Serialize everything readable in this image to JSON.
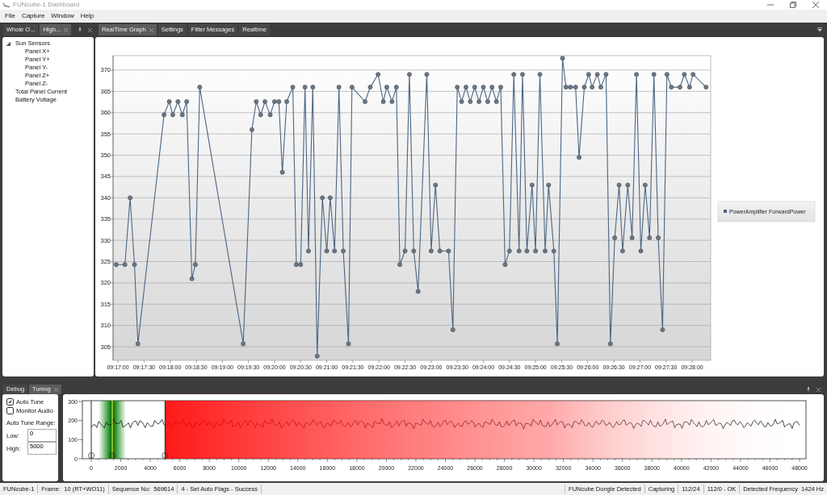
{
  "window": {
    "title": "FUNcube-1 Dashboard"
  },
  "menu": [
    "File",
    "Capture",
    "Window",
    "Help"
  ],
  "left_dock": {
    "tabs": [
      {
        "label": "Whole O...",
        "selected": false
      },
      {
        "label": "High...",
        "selected": true
      }
    ],
    "tree": [
      {
        "label": "Sun Sensors",
        "expanded": true,
        "children": [
          {
            "label": "Panel X+"
          },
          {
            "label": "Panel Y+"
          },
          {
            "label": "Panel Y-"
          },
          {
            "label": "Panel Z+"
          },
          {
            "label": "Panel Z-"
          }
        ]
      },
      {
        "label": "Total Panel Current"
      },
      {
        "label": "Battery Voltage"
      }
    ]
  },
  "main_dock": {
    "tabs": [
      {
        "label": "RealTime Graph",
        "selected": true
      },
      {
        "label": "Settings",
        "selected": false
      },
      {
        "label": "Fitter Messages",
        "selected": false
      },
      {
        "label": "Realtime",
        "selected": false
      }
    ],
    "chart_data": {
      "type": "line",
      "grid": true,
      "xlim": [
        33414.4,
        34101.3
      ],
      "ylim": [
        301.8,
        373.4
      ],
      "yticks": [
        305,
        310,
        315,
        320,
        325,
        330,
        335,
        340,
        345,
        350,
        355,
        360,
        365,
        370
      ],
      "xticks": [
        {
          "value": 33420,
          "label": "09:17:00"
        },
        {
          "value": 33450,
          "label": "09:17:30"
        },
        {
          "value": 33480,
          "label": "09:18:00"
        },
        {
          "value": 33510,
          "label": "09:18:30"
        },
        {
          "value": 33540,
          "label": "09:19:00"
        },
        {
          "value": 33570,
          "label": "09:19:30"
        },
        {
          "value": 33600,
          "label": "09:20:00"
        },
        {
          "value": 33630,
          "label": "09:20:30"
        },
        {
          "value": 33660,
          "label": "09:21:00"
        },
        {
          "value": 33690,
          "label": "09:21:30"
        },
        {
          "value": 33720,
          "label": "09:22:00"
        },
        {
          "value": 33750,
          "label": "09:22:30"
        },
        {
          "value": 33780,
          "label": "09:23:00"
        },
        {
          "value": 33810,
          "label": "09:23:30"
        },
        {
          "value": 33840,
          "label": "09:24:00"
        },
        {
          "value": 33870,
          "label": "09:24:30"
        },
        {
          "value": 33900,
          "label": "09:25:00"
        },
        {
          "value": 33930,
          "label": "09:25:30"
        },
        {
          "value": 33960,
          "label": "09:26:00"
        },
        {
          "value": 33990,
          "label": "09:26:30"
        },
        {
          "value": 34020,
          "label": "09:27:00"
        },
        {
          "value": 34050,
          "label": "09:27:30"
        },
        {
          "value": 34080,
          "label": "09:28:00"
        }
      ],
      "x": [
        33418,
        33428,
        33434,
        33439,
        33443,
        33473,
        33479,
        33483,
        33489,
        33494,
        33499,
        33505,
        33509,
        33514,
        33564,
        33574,
        33579,
        33584,
        33589,
        33595,
        33600,
        33605,
        33609,
        33614,
        33621,
        33625,
        33630,
        33635,
        33639,
        33644,
        33649,
        33655,
        33660,
        33664,
        33669,
        33674,
        33679,
        33685,
        33689,
        33704,
        33710,
        33719,
        33725,
        33729,
        33735,
        33740,
        33744,
        33750,
        33755,
        33760,
        33765,
        33775,
        33780,
        33785,
        33790,
        33800,
        33805,
        33810,
        33815,
        33820,
        33825,
        33830,
        33835,
        33840,
        33845,
        33850,
        33855,
        33860,
        33865,
        33870,
        33875,
        33881,
        33885,
        33890,
        33896,
        33900,
        33905,
        33911,
        33915,
        33921,
        33925,
        33931,
        33935,
        33940,
        33946,
        33950,
        33956,
        33961,
        33965,
        33971,
        33975,
        33981,
        33986,
        33991,
        33996,
        34000,
        34006,
        34011,
        34016,
        34021,
        34026,
        34031,
        34036,
        34041,
        34046,
        34051,
        34056,
        34066,
        34071,
        34077,
        34081,
        34096
      ],
      "series": [
        {
          "name": "PowerAmplifier ForwardPower",
          "color": "#4b6683",
          "marker": true,
          "values": [
            324.3,
            324.3,
            340,
            324.3,
            305.7,
            359.5,
            362.6,
            359.5,
            362.6,
            359.5,
            362.6,
            321,
            324.3,
            366,
            305.7,
            356,
            362.6,
            359.5,
            362.6,
            359.5,
            362.6,
            362.6,
            346,
            362.6,
            366,
            324.3,
            324.3,
            366,
            327.5,
            366,
            302.8,
            340,
            327.5,
            340,
            327.5,
            366,
            327.5,
            305.7,
            366,
            362.6,
            366,
            369,
            362.6,
            366,
            362.6,
            366,
            324.3,
            327.5,
            369,
            327.5,
            318,
            369,
            327.5,
            343,
            327.5,
            327.5,
            309,
            366,
            362.6,
            366,
            362.6,
            366,
            362.6,
            366,
            362.6,
            366,
            362.6,
            366,
            324.3,
            327.5,
            369,
            327.5,
            369,
            327.5,
            343,
            327.5,
            369,
            327.5,
            343,
            327.5,
            305.7,
            372.8,
            366,
            366,
            366,
            349.5,
            366,
            369,
            366,
            369,
            366,
            369,
            305.7,
            330.6,
            343,
            327.5,
            343,
            330.6,
            369,
            327.5,
            343,
            330.6,
            369,
            330.6,
            309,
            369,
            366,
            366,
            369,
            366,
            369,
            366
          ]
        }
      ]
    }
  },
  "bottom_dock": {
    "tabs": [
      {
        "label": "Debug",
        "selected": false
      },
      {
        "label": "Tuning",
        "selected": true
      }
    ],
    "options": [
      {
        "label": "Auto Tune",
        "checked": true
      },
      {
        "label": "Monitor Audio",
        "checked": false
      }
    ],
    "range_label": "Auto Tune Range:",
    "fields": [
      {
        "label": "Low:",
        "value": "0"
      },
      {
        "label": "High:",
        "value": "5000"
      }
    ],
    "spectrum": {
      "yticks": [
        "300",
        "200",
        "100",
        "0"
      ],
      "xticks": [
        "0",
        "2000",
        "4000",
        "6000",
        "8000",
        "10000",
        "12000",
        "14000",
        "16000",
        "18000",
        "20000",
        "22000",
        "24000",
        "26000",
        "28000",
        "30000",
        "32000",
        "34000",
        "36000",
        "38000",
        "40000",
        "42000",
        "44000",
        "46000",
        "48000"
      ]
    }
  },
  "status_bar": {
    "left": [
      "FUNcube-1",
      "Frame:  10 (RT+WO11)",
      "Sequence No:  569614",
      "4 - Set Auto Flags - Success"
    ],
    "right": [
      "FUNcube Dongle Detected",
      "Capturing",
      "112/24",
      "112/0 - OK",
      "Detected Frequency  1424 Hz"
    ]
  }
}
